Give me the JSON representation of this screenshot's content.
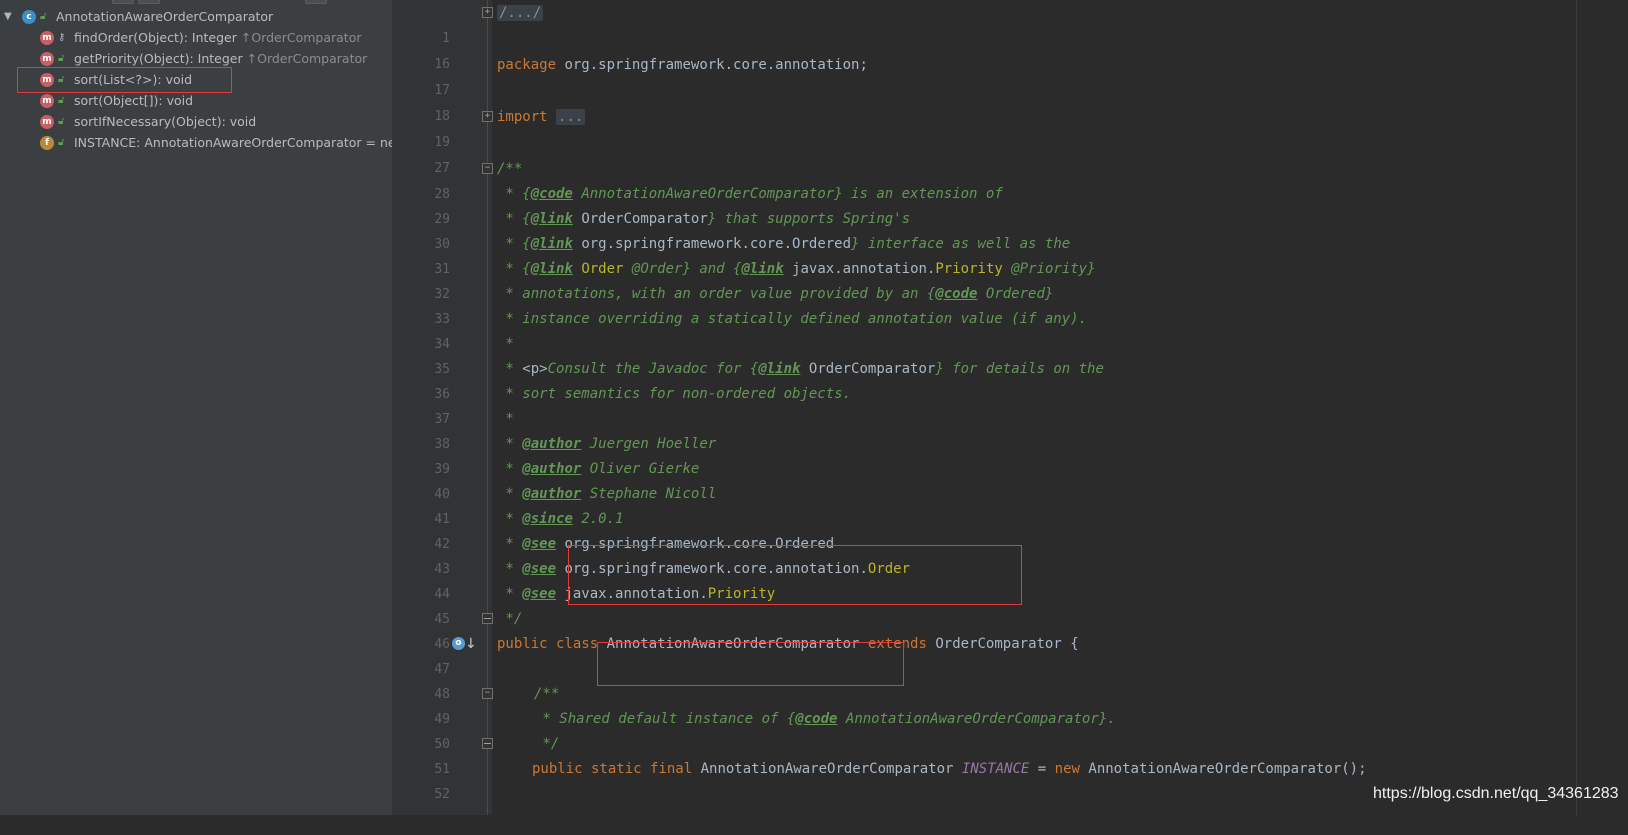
{
  "structure": {
    "items": [
      {
        "name": "AnnotationAwareOrderComparator",
        "detail": "",
        "badge": "C"
      },
      {
        "name": "findOrder(Object): Integer",
        "inherited": "OrderComparator",
        "badge": "m"
      },
      {
        "name": "getPriority(Object): Integer",
        "inherited": "OrderComparator",
        "badge": "m"
      },
      {
        "name": "sort(List<?>): void",
        "badge": "m"
      },
      {
        "name": "sort(Object[]): void",
        "badge": "m"
      },
      {
        "name": "sortIfNecessary(Object): void",
        "badge": "m"
      },
      {
        "name": "INSTANCE: AnnotationAwareOrderComparator = new",
        "badge": "f"
      }
    ],
    "inherit_arrow": "↑"
  },
  "editor": {
    "line_numbers": [
      "1",
      "16",
      "17",
      "18",
      "19",
      "27",
      "28",
      "29",
      "30",
      "31",
      "32",
      "33",
      "34",
      "35",
      "36",
      "37",
      "38",
      "39",
      "40",
      "41",
      "42",
      "43",
      "44",
      "45",
      "46",
      "47",
      "48",
      "49",
      "50",
      "51",
      "52"
    ],
    "l1": "/.../",
    "l17": {
      "kw": "package",
      "rest": "org.springframework.core.annotation;"
    },
    "l19": {
      "kw": "import",
      "fold": "..."
    },
    "l28": "/**",
    "l29": {
      "a": " * {",
      "tag": "@code",
      "ref": "AnnotationAwareOrderComparator",
      "b": "} is an extension of"
    },
    "l30": {
      "a": " * {",
      "tag": "@link",
      "ref": "OrderComparator",
      "b": "} that supports Spring's"
    },
    "l31": {
      "a": " * {",
      "tag": "@link",
      "ref": "org.springframework.core.Ordered",
      "b": "} interface as well as the"
    },
    "l32": {
      "a": " * {",
      "tag": "@link",
      "ref": "Order",
      "b": " @Order} and {",
      "tag2": "@link",
      "ref2a": "javax.annotation.",
      "ref2b": "Priority",
      "c": " @Priority}"
    },
    "l33": {
      "a": " * annotations, with an order value provided by an {",
      "tag": "@code",
      "ref": "Ordered",
      "b": "}"
    },
    "l34": " * instance overriding a statically defined annotation value (if any).",
    "l35": " *",
    "l36": {
      "a": " * ",
      "p": "<p>",
      "b": "Consult the Javadoc for {",
      "tag": "@link",
      "ref": "OrderComparator",
      "c": "} for details on the"
    },
    "l37": " * sort semantics for non-ordered objects.",
    "l38": " *",
    "l39": {
      "tag": "@author",
      "b": "Juergen Hoeller"
    },
    "l40": {
      "tag": "@author",
      "b": "Oliver Gierke"
    },
    "l41": {
      "tag": "@author",
      "b": "Stephane Nicoll"
    },
    "l42": {
      "tag": "@since",
      "b": "2.0.1"
    },
    "l43": {
      "tag": "@see",
      "ref": "org.springframework.core.Ordered"
    },
    "l44": {
      "tag": "@see",
      "ref": "org.springframework.core.annotation.",
      "yl": "Order"
    },
    "l45": {
      "tag": "@see",
      "ref": "javax.annotation.",
      "yl": "Priority"
    },
    "l46": " */",
    "l47": {
      "kw1": "public class",
      "name": "AnnotationAwareOrderComparator",
      "kw2": "extends",
      "sup": "OrderComparator {"
    },
    "l49": "/**",
    "l50": {
      "a": " * Shared default instance of {",
      "tag": "@code",
      "ref": "AnnotationAwareOrderComparator",
      "b": "}."
    },
    "l51": " */",
    "l52": {
      "kw": "public static final",
      "type": "AnnotationAwareOrderComparator",
      "field": "INSTANCE",
      "eq": "=",
      "kw2": "new",
      "ctor": "AnnotationAwareOrderComparator();"
    }
  },
  "watermark": "https://blog.csdn.net/qq_34361283",
  "colors": {
    "highlight": "#e03c3c",
    "keyword": "#cc7832",
    "comment": "#629755"
  }
}
